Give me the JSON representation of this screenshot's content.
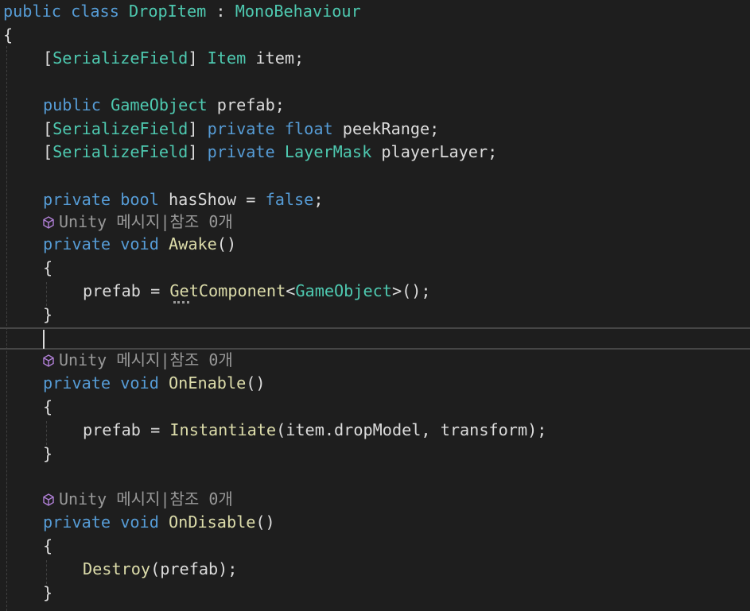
{
  "editor": {
    "class_decl": {
      "kw_public": "public",
      "kw_class": "class",
      "class_name": "DropItem",
      "colon": " : ",
      "base": "MonoBehaviour"
    },
    "brace_open": "{",
    "brace_close": "}",
    "field_item": {
      "attr_open": "[",
      "attr": "SerializeField",
      "attr_close": "]",
      "type": "Item",
      "rest": " item;"
    },
    "field_prefab": {
      "kw": "public",
      "type": "GameObject",
      "rest": " prefab;"
    },
    "field_peek": {
      "attr_open": "[",
      "attr": "SerializeField",
      "attr_close": "]",
      "kw": "private",
      "type": "float",
      "rest": " peekRange;"
    },
    "field_layer": {
      "attr_open": "[",
      "attr": "SerializeField",
      "attr_close": "]",
      "kw": "private",
      "type": "LayerMask",
      "rest": " playerLayer;"
    },
    "field_hasshow": {
      "kw": "private",
      "type": "bool",
      "mid": " hasShow = ",
      "value": "false",
      "end": ";"
    },
    "codelens_text": "Unity 메시지|참조 0개",
    "method_awake": {
      "kw": "private",
      "ret": "void",
      "name": "Awake",
      "params": "()",
      "body_lhs": "prefab = ",
      "body_call": "GetComponent",
      "body_lt": "<",
      "body_type": "GameObject",
      "body_rest": ">();"
    },
    "method_enable": {
      "kw": "private",
      "ret": "void",
      "name": "OnEnable",
      "params": "()",
      "body_lhs": "prefab = ",
      "body_call": "Instantiate",
      "body_rest": "(item.dropModel, transform);"
    },
    "method_disable": {
      "kw": "private",
      "ret": "void",
      "name": "OnDisable",
      "params": "()",
      "body_call": "Destroy",
      "body_rest": "(prefab);"
    }
  },
  "colors": {
    "background": "#1e1e1e",
    "keyword": "#569cd6",
    "type": "#4ec9b0",
    "method": "#dcdcaa",
    "plain": "#dcdcdc",
    "codelens": "#999999"
  },
  "icons": {
    "codelens": "unity-cube-icon"
  }
}
